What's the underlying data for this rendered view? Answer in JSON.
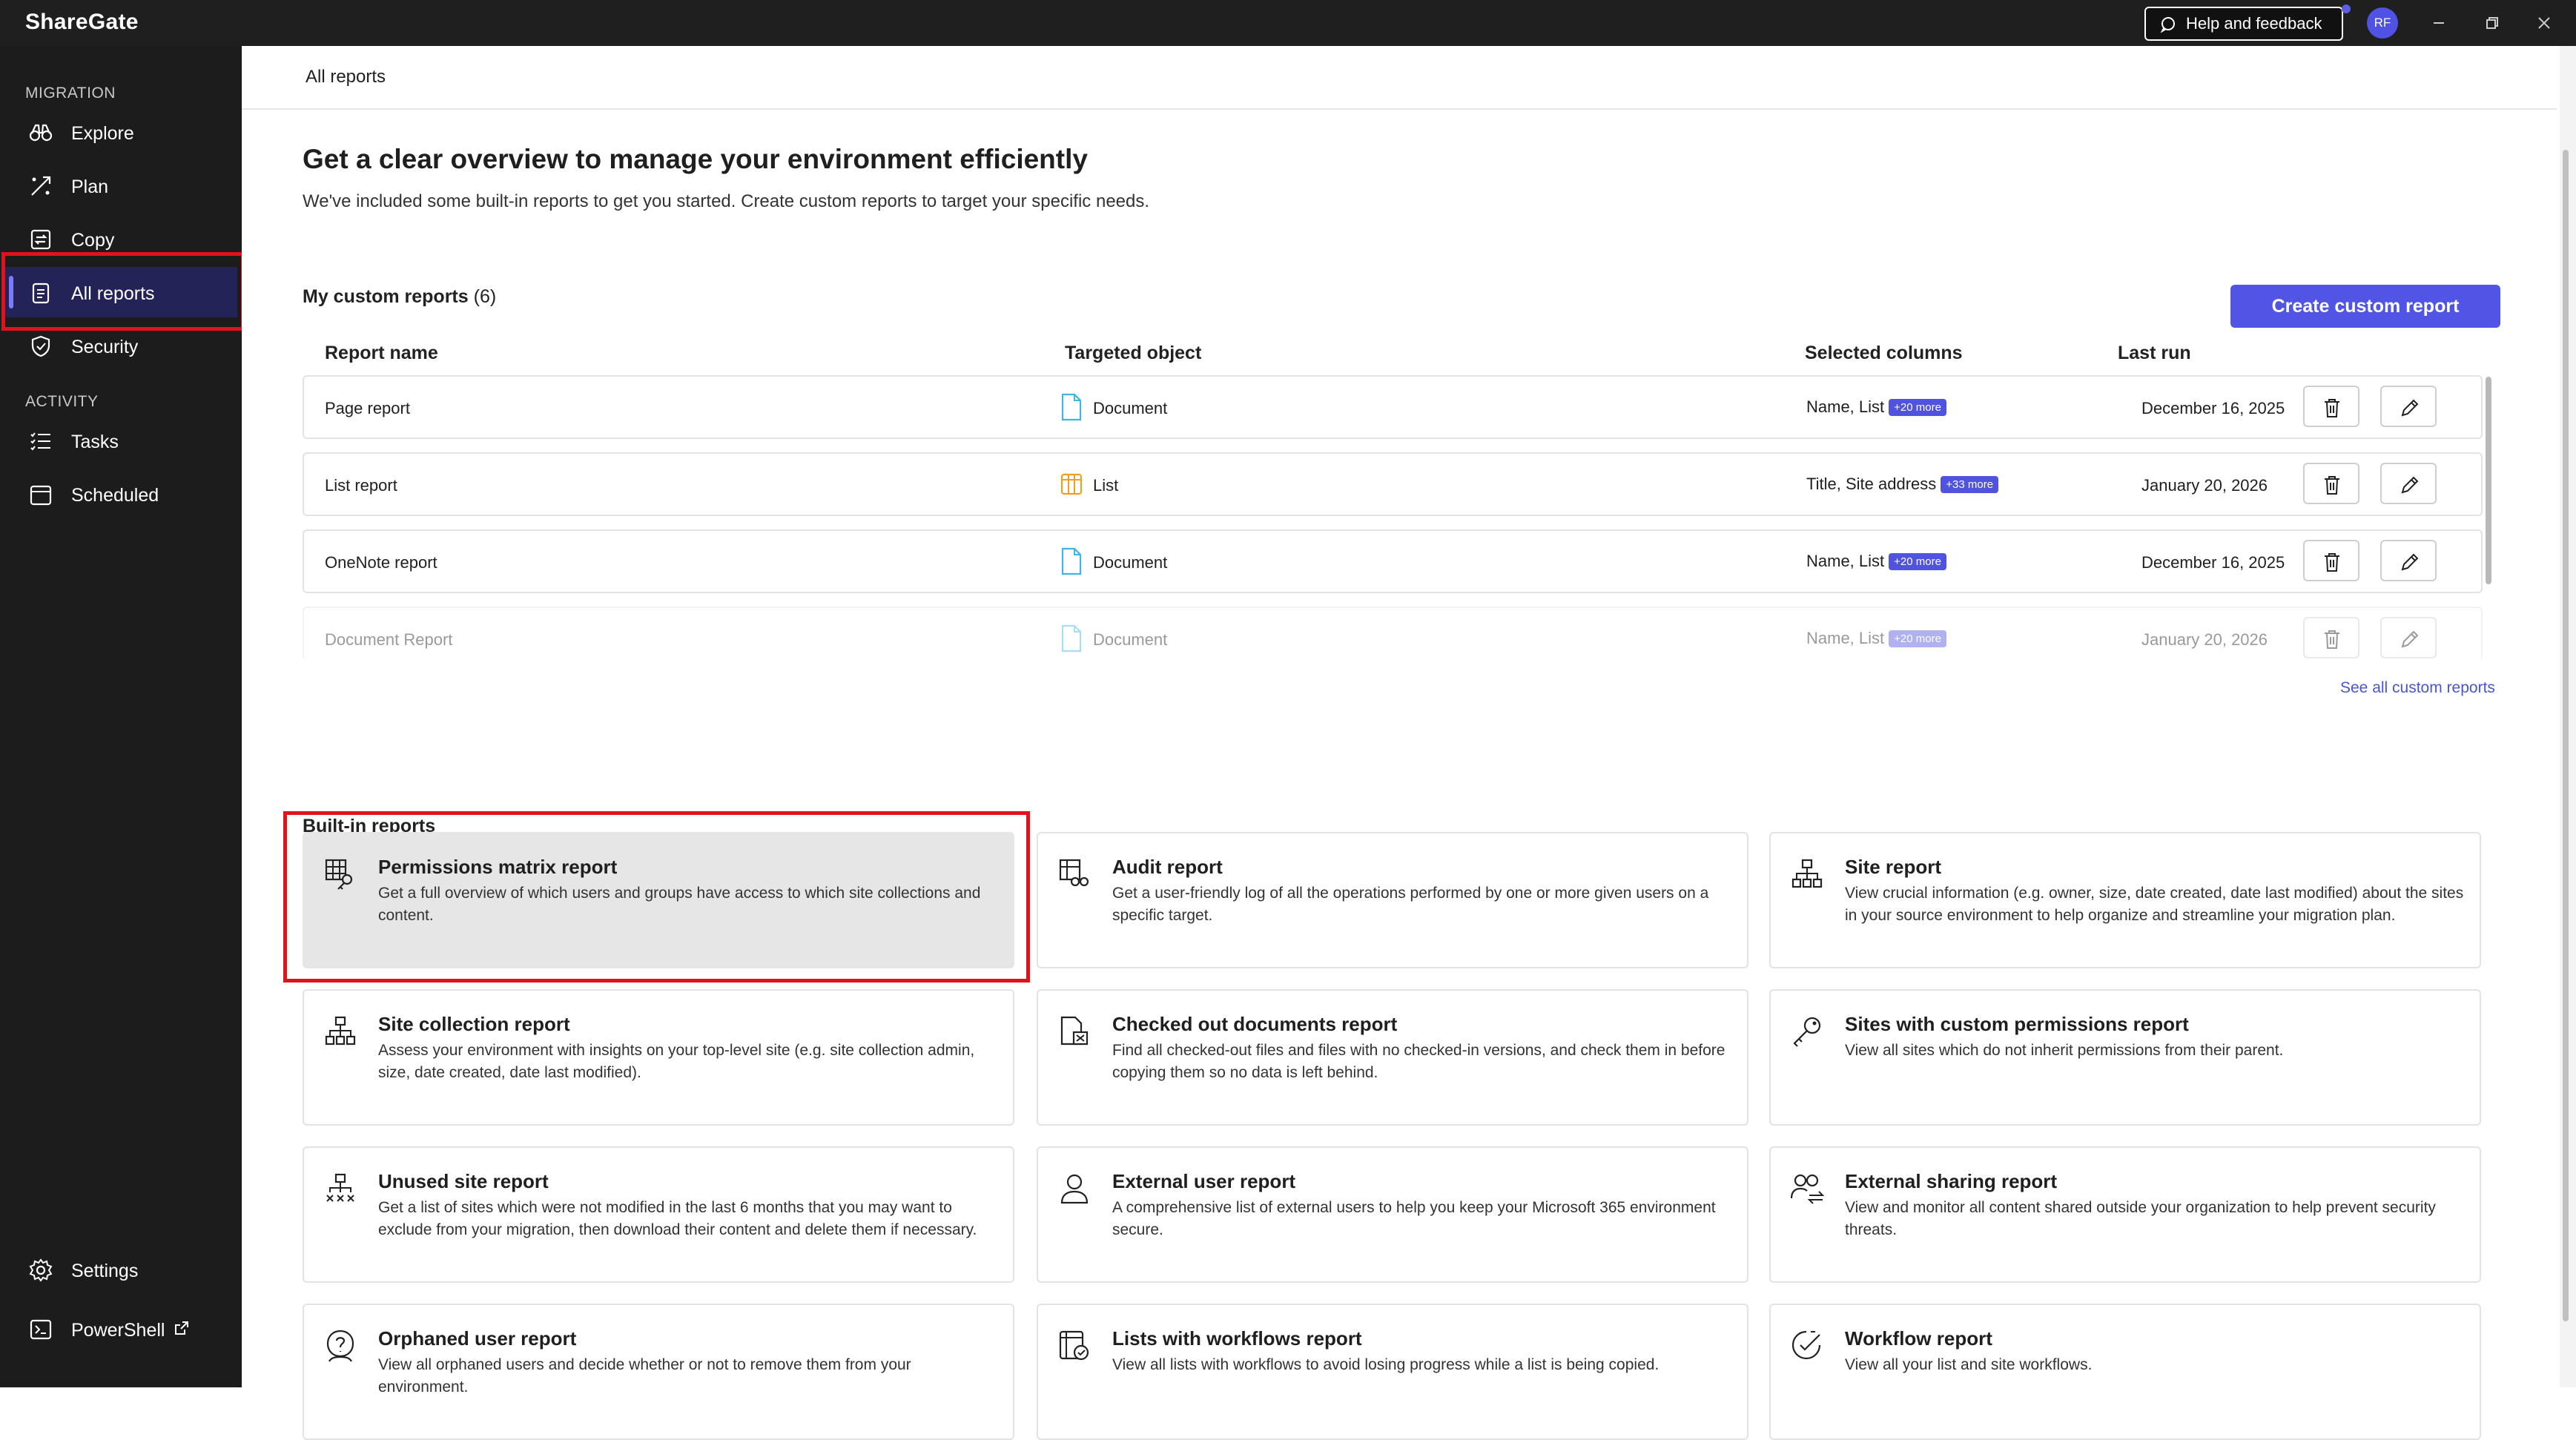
{
  "app": {
    "title": "ShareGate",
    "help_label": "Help and feedback",
    "user_initials": "RF"
  },
  "sidebar": {
    "migration_label": "MIGRATION",
    "activity_label": "ACTIVITY",
    "items": [
      {
        "label": "Explore",
        "icon": "binoculars-icon"
      },
      {
        "label": "Plan",
        "icon": "plan-icon"
      },
      {
        "label": "Copy",
        "icon": "copy-icon"
      },
      {
        "label": "All reports",
        "icon": "reports-icon",
        "active": true
      },
      {
        "label": "Security",
        "icon": "shield-icon"
      },
      {
        "label": "Tasks",
        "icon": "tasks-icon"
      },
      {
        "label": "Scheduled",
        "icon": "calendar-icon"
      },
      {
        "label": "Settings",
        "icon": "gear-icon"
      },
      {
        "label": "PowerShell",
        "icon": "powershell-icon"
      }
    ]
  },
  "breadcrumb": "All reports",
  "header": {
    "title": "Get a clear overview to manage your environment efficiently",
    "subtitle": "We've included some built-in reports to get you started. Create custom reports to target your specific needs."
  },
  "custom_reports": {
    "title": "My custom reports",
    "count": "(6)",
    "create_label": "Create custom report",
    "see_all_label": "See all custom reports",
    "columns": [
      "Report name",
      "Targeted object",
      "Selected columns",
      "Last run"
    ],
    "rows": [
      {
        "name": "Page report",
        "object": "Document",
        "columns": "Name, List",
        "more": "+20 more",
        "last_run": "December 16, 2025"
      },
      {
        "name": "List report",
        "object": "List",
        "columns": "Title, Site address",
        "more": "+33 more",
        "last_run": "January 20, 2026"
      },
      {
        "name": "OneNote report",
        "object": "Document",
        "columns": "Name, List",
        "more": "+20 more",
        "last_run": "December 16, 2025"
      },
      {
        "name": "Document Report",
        "object": "Document",
        "columns": "Name, List",
        "more": "+20 more",
        "last_run": "January 20, 2026"
      }
    ]
  },
  "builtin": {
    "title": "Built-in reports",
    "cards": [
      {
        "title": "Permissions matrix report",
        "desc": "Get a full overview of which users and groups have access to which site collections and content.",
        "icon": "permissions-matrix-icon"
      },
      {
        "title": "Audit report",
        "desc": "Get a user-friendly log of all the operations performed by one or more given users on a specific target.",
        "icon": "audit-icon"
      },
      {
        "title": "Site report",
        "desc": "View crucial information (e.g. owner, size, date created, date last modified) about the sites in your source environment to help organize and streamline your migration plan.",
        "icon": "site-hierarchy-icon"
      },
      {
        "title": "Site collection report",
        "desc": "Assess your environment with insights on your top-level site (e.g. site collection admin, size, date created, date last modified).",
        "icon": "site-collection-icon"
      },
      {
        "title": "Checked out documents report",
        "desc": "Find all checked-out files and files with no checked-in versions, and check them in before copying them so no data is left behind.",
        "icon": "checked-out-doc-icon"
      },
      {
        "title": "Sites with custom permissions report",
        "desc": "View all sites which do not inherit permissions from their parent.",
        "icon": "key-icon"
      },
      {
        "title": "Unused site report",
        "desc": "Get a list of sites which were not modified in the last 6 months that you may want to exclude from your migration, then download their content and delete them if necessary.",
        "icon": "unused-site-icon"
      },
      {
        "title": "External user report",
        "desc": "A comprehensive list of external users to help you keep your Microsoft 365 environment secure.",
        "icon": "external-user-icon"
      },
      {
        "title": "External sharing report",
        "desc": "View and monitor all content shared outside your organization to help prevent security threats.",
        "icon": "external-sharing-icon"
      },
      {
        "title": "Orphaned user report",
        "desc": "View all orphaned users and decide whether or not to remove them from your environment.",
        "icon": "orphaned-user-icon"
      },
      {
        "title": "Lists with workflows report",
        "desc": "View all lists with workflows to avoid losing progress while a list is being copied.",
        "icon": "list-workflow-icon"
      },
      {
        "title": "Workflow report",
        "desc": "View all your list and site workflows.",
        "icon": "workflow-icon"
      }
    ]
  },
  "colors": {
    "accent": "#5055e6",
    "sidebar_bg": "#1c1c1c",
    "highlight": "#e0121b",
    "badge": "#4f53e0"
  }
}
